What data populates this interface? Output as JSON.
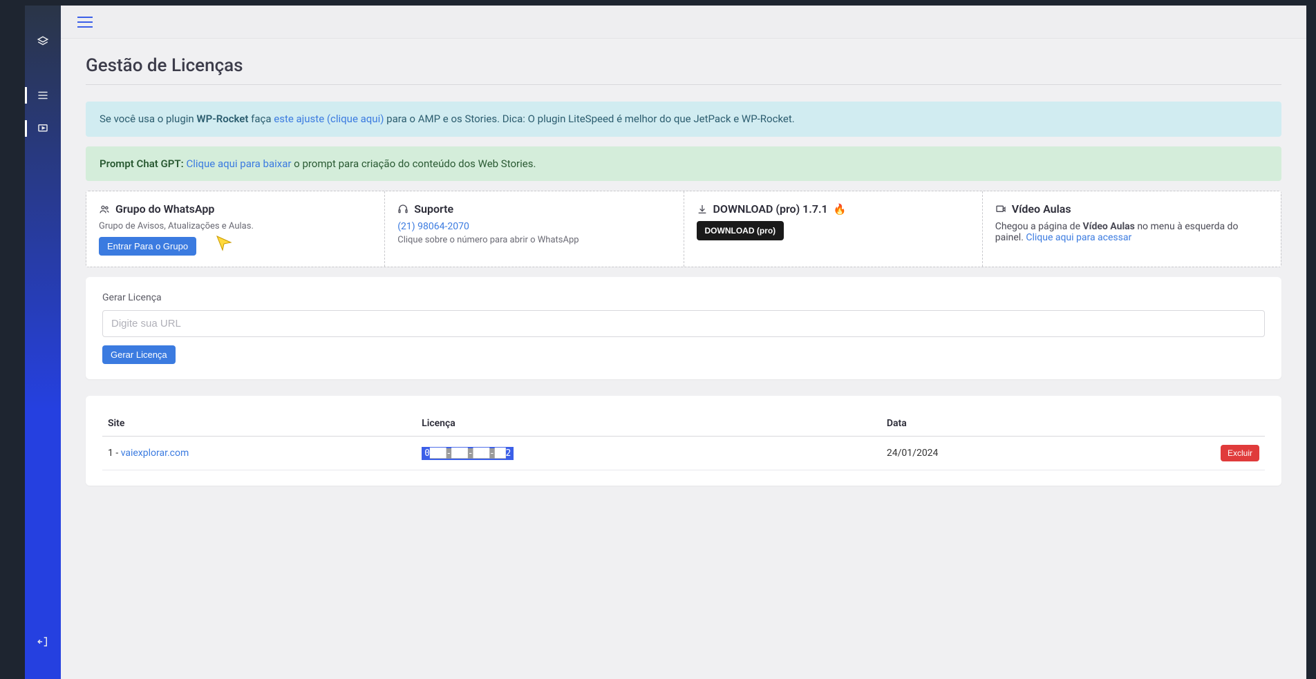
{
  "page": {
    "title": "Gestão de Licenças"
  },
  "alerts": {
    "info": {
      "prefix": "Se você usa o plugin ",
      "strong": "WP-Rocket",
      "mid": " faça ",
      "link": "este ajuste (clique aqui)",
      "suffix": " para o AMP e os Stories. Dica: O plugin LiteSpeed é melhor do que JetPack e WP-Rocket."
    },
    "success": {
      "strong": "Prompt Chat GPT: ",
      "link": "Clique aqui para baixar",
      "suffix": " o prompt para criação do conteúdo dos Web Stories."
    }
  },
  "cards": {
    "whatsapp": {
      "title": "Grupo do WhatsApp",
      "desc": "Grupo de Avisos, Atualizações e Aulas.",
      "button": "Entrar Para o Grupo"
    },
    "suporte": {
      "title": "Suporte",
      "phone": "(21) 98064-2070",
      "desc": "Clique sobre o número para abrir o WhatsApp"
    },
    "download": {
      "title": "DOWNLOAD (pro) 1.7.1",
      "button": "DOWNLOAD (pro)"
    },
    "video": {
      "title": "Vídeo Aulas",
      "prefix": "Chegou a página de ",
      "strong": "Vídeo Aulas",
      "mid": " no menu à esquerda do painel. ",
      "link": "Clique aqui para acessar"
    }
  },
  "generate": {
    "label": "Gerar Licença",
    "placeholder": "Digite sua URL",
    "button": "Gerar Licença"
  },
  "table": {
    "headers": {
      "site": "Site",
      "license": "Licença",
      "date": "Data"
    },
    "rows": [
      {
        "index": "1 - ",
        "site": "vaiexplorar.com",
        "license_start": "0",
        "license_mid": "███-███-███-██",
        "license_end": "2",
        "date": "24/01/2024",
        "action": "Excluir"
      }
    ]
  }
}
